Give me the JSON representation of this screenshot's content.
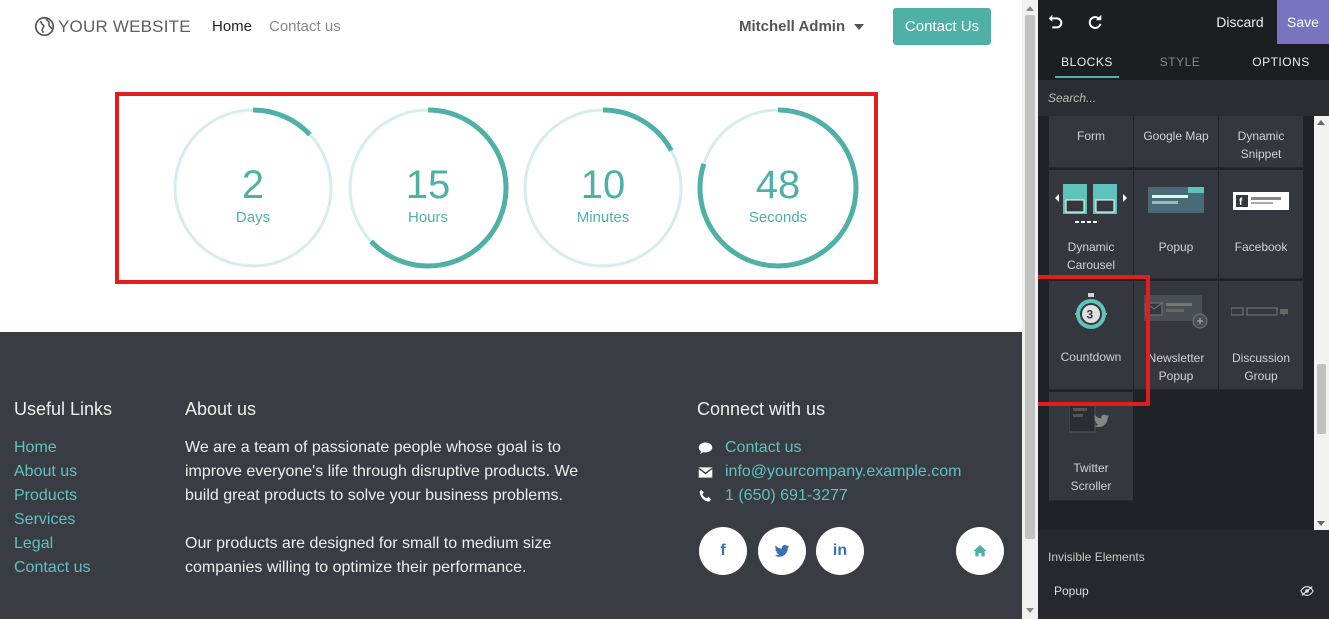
{
  "site": {
    "logo_text": "YOUR WEBSITE",
    "nav": [
      {
        "label": "Home",
        "active": true
      },
      {
        "label": "Contact us",
        "active": false
      }
    ],
    "user": "Mitchell Admin",
    "contact_button": "Contact Us"
  },
  "countdown": {
    "accent_color": "#4fb0a8",
    "units": [
      {
        "value": "2",
        "label": "Days",
        "fraction": 0.13
      },
      {
        "value": "15",
        "label": "Hours",
        "fraction": 0.63
      },
      {
        "value": "10",
        "label": "Minutes",
        "fraction": 0.17
      },
      {
        "value": "48",
        "label": "Seconds",
        "fraction": 0.8
      }
    ]
  },
  "footer": {
    "useful_links_title": "Useful Links",
    "useful_links": [
      "Home",
      "About us",
      "Products",
      "Services",
      "Legal",
      "Contact us"
    ],
    "about_title": "About us",
    "about_p1": "We are a team of passionate people whose goal is to improve everyone's life through disruptive products. We build great products to solve your business problems.",
    "about_p2": "Our products are designed for small to medium size companies willing to optimize their performance.",
    "connect_title": "Connect with us",
    "contact_link": "Contact us",
    "email": "info@yourcompany.example.com",
    "phone": "1 (650) 691-3277",
    "social": [
      {
        "icon": "facebook-icon",
        "glyph": "f"
      },
      {
        "icon": "twitter-icon",
        "glyph": ""
      },
      {
        "icon": "linkedin-icon",
        "glyph": "in"
      },
      {
        "icon": "home-icon",
        "glyph": ""
      }
    ]
  },
  "editor": {
    "discard": "Discard",
    "save": "Save",
    "tabs": [
      "BLOCKS",
      "STYLE",
      "OPTIONS"
    ],
    "search_placeholder": "Search...",
    "blocks": [
      {
        "label": "Form",
        "icon": "form-icon"
      },
      {
        "label": "Google Map",
        "icon": "map-icon"
      },
      {
        "label": "Dynamic Snippet",
        "icon": "dynamic-snippet-icon"
      },
      {
        "label": "Dynamic Carousel",
        "icon": "carousel-icon"
      },
      {
        "label": "Popup",
        "icon": "popup-icon"
      },
      {
        "label": "Facebook",
        "icon": "facebook-page-icon"
      },
      {
        "label": "Countdown",
        "icon": "countdown-icon",
        "badge": "3"
      },
      {
        "label": "Newsletter Popup",
        "icon": "newsletter-popup-icon"
      },
      {
        "label": "Discussion Group",
        "icon": "discussion-group-icon"
      },
      {
        "label": "Twitter Scroller",
        "icon": "twitter-scroller-icon"
      }
    ],
    "invisible_title": "Invisible Elements",
    "invisible_items": [
      "Popup"
    ]
  }
}
